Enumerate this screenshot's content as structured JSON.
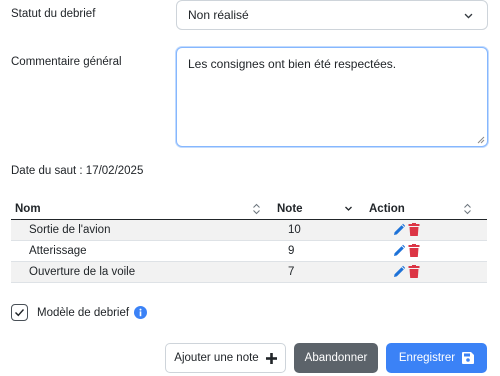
{
  "form": {
    "statut_label": "Statut du debrief",
    "statut_value": "Non réalisé",
    "commentaire_label": "Commentaire général",
    "commentaire_value": "Les consignes ont bien été respectées.",
    "date_text": "Date du saut : 17/02/2025"
  },
  "table": {
    "headers": {
      "nom": "Nom",
      "note": "Note",
      "action": "Action"
    },
    "rows": [
      {
        "nom": "Sortie de l'avion",
        "note": "10"
      },
      {
        "nom": "Atterissage",
        "note": "9"
      },
      {
        "nom": "Ouverture de la voile",
        "note": "7"
      }
    ]
  },
  "checkbox": {
    "label": "Modèle de debrief",
    "checked": true
  },
  "buttons": {
    "add_note": "Ajouter une note",
    "abandon": "Abandonner",
    "save": "Enregistrer"
  },
  "colors": {
    "edit_icon": "#1d72d8",
    "delete_icon": "#dc3545",
    "info_icon": "#3b82f6",
    "save_button": "#3b82f6",
    "abandon_button": "#5c636a"
  },
  "icons": {
    "select_chevron": "chevron-down-icon",
    "sort": "sort-icon",
    "edit": "pencil-icon",
    "delete": "trash-icon",
    "info": "info-icon",
    "add": "plus-icon",
    "save": "floppy-disk-icon"
  }
}
